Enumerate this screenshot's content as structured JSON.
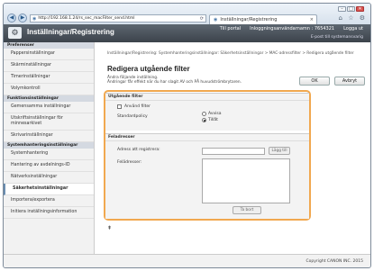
{
  "browser": {
    "url": "http://192.168.1.24/rs_sec_macFilter_send.html",
    "tab_title": "Inställningar/Registrering",
    "back_icon": "back-arrow-icon",
    "forward_icon": "forward-arrow-icon",
    "min_glyph": "–",
    "max_glyph": "□",
    "close_glyph": "✕",
    "tab_close": "×",
    "tools": "⌂ ☆ ⚙"
  },
  "header": {
    "title": "Inställningar/Registrering",
    "links": [
      "Till portal",
      "Inloggningsanvändarnamn : 7654321",
      "Logga ut"
    ],
    "email": "E-post till systemansvarig"
  },
  "sidebar": {
    "sections": [
      {
        "title": "Preferenser",
        "items": [
          "Pappersinställningar",
          "Skärminställningar",
          "Timerinställningar",
          "Volymkontroll"
        ]
      },
      {
        "title": "Funktionsinställningar",
        "items": [
          "Gemensamma inställningar",
          "Utskriftsinställningar för minnesarkivet",
          "Skrivarinställningar"
        ]
      },
      {
        "title": "Systemhanteringsinställningar",
        "items": [
          "Systemhantering",
          "Hantering av avdelnings-ID",
          "Nätverksinställningar",
          "Säkerhetsinställningar",
          "Importera/exportera",
          "Initiera inställningsinformation"
        ]
      }
    ],
    "selected": "Säkerhetsinställningar"
  },
  "main": {
    "breadcrumb": "Inställningar/Registrering: Systemhanteringsinställningar: Säkerhetsinställningar > MAC-adressfilter > Redigera utgående filter",
    "title": "Redigera utgående filter",
    "instructions": [
      "Ändra följande inställning.",
      "Ändringar får effekt när du har slagit AV och PÅ huvudströmbrytaren."
    ],
    "ok_label": "OK",
    "cancel_label": "Avbryt",
    "outgoing": {
      "heading": "Utgående filter",
      "use_filter_label": "Använd filter",
      "policy_label": "Standardpolicy",
      "reject_label": "Avvisa",
      "allow_label": "Tillåt"
    },
    "exceptions": {
      "heading": "Feladresser",
      "register_label": "Adress att registrera:",
      "add_label": "Lägg till",
      "list_label": "Felädresser:",
      "delete_label": "Ta bort"
    },
    "top_icon": "⇞"
  },
  "footer": {
    "copyright": "Copyright CANON INC. 2015"
  }
}
